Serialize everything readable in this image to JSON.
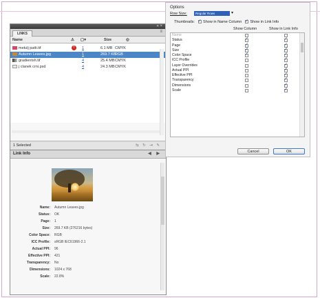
{
  "links_panel": {
    "title_controls": "« ×",
    "tab": "LINKS",
    "menu_icon": "≡",
    "columns": {
      "name": "Name",
      "size": "Size"
    },
    "rows": [
      {
        "name": "metulj patti.tif",
        "page": "1",
        "size": "6.1 MB",
        "space": "CMYK",
        "warning": "!",
        "selected": false
      },
      {
        "name": "Autumn Leaves.jpg",
        "page": "1",
        "size": "269.7 KB",
        "space": "RGB",
        "warning": "",
        "selected": true
      },
      {
        "name": "gradientsh.tif",
        "page": "4",
        "size": "25.4 MB",
        "space": "CMYK",
        "warning": "",
        "selected": false
      },
      {
        "name": "j clanek crni.psd",
        "page": "4",
        "size": "24.3 MB",
        "space": "CMYK",
        "warning": "",
        "selected": false
      }
    ],
    "footer": {
      "selected_text": "1 Selected"
    }
  },
  "link_info": {
    "title": "Link Info",
    "nav": "◀ ▶",
    "properties": [
      {
        "key": "Name:",
        "value": "Autumn Leaves.jpg"
      },
      {
        "key": "Status:",
        "value": "OK"
      },
      {
        "key": "Page:",
        "value": "1"
      },
      {
        "key": "Size:",
        "value": "269.7 KB (276216 bytes)"
      },
      {
        "key": "Color Space:",
        "value": "RGB"
      },
      {
        "key": "ICC Profile:",
        "value": "sRGB IEC61966-2.1"
      },
      {
        "key": "Actual PPI:",
        "value": "96"
      },
      {
        "key": "Effective PPI:",
        "value": "421"
      },
      {
        "key": "Transparency:",
        "value": "No"
      },
      {
        "key": "Dimensions:",
        "value": "1024 x 768"
      },
      {
        "key": "Scale:",
        "value": "22.8%"
      }
    ]
  },
  "options": {
    "title": "Options",
    "row_size_label": "Row Size:",
    "row_size_value": "Regular Rows",
    "thumbnails_label": "Thumbnails:",
    "thumbnails_name_column": "Show in Name Column",
    "thumbnails_link_info": "Show in Link Info",
    "col_show_column": "Show Column",
    "col_show_link_info": "Show in Link Info",
    "items": [
      {
        "name": "Name",
        "column": false,
        "info": false,
        "header": true
      },
      {
        "name": "Status",
        "column": true,
        "info": true
      },
      {
        "name": "Page",
        "column": true,
        "info": true
      },
      {
        "name": "Size",
        "column": true,
        "info": true
      },
      {
        "name": "Color Space",
        "column": true,
        "info": true
      },
      {
        "name": "ICC Profile",
        "column": false,
        "info": true
      },
      {
        "name": "Layer Overrides",
        "column": false,
        "info": true
      },
      {
        "name": "Actual PPI",
        "column": false,
        "info": true
      },
      {
        "name": "Effective PPI",
        "column": false,
        "info": true
      },
      {
        "name": "Transparency",
        "column": false,
        "info": true
      },
      {
        "name": "Dimensions",
        "column": false,
        "info": true
      },
      {
        "name": "Scale",
        "column": false,
        "info": true
      }
    ],
    "cancel_label": "Cancel",
    "ok_label": "OK"
  }
}
